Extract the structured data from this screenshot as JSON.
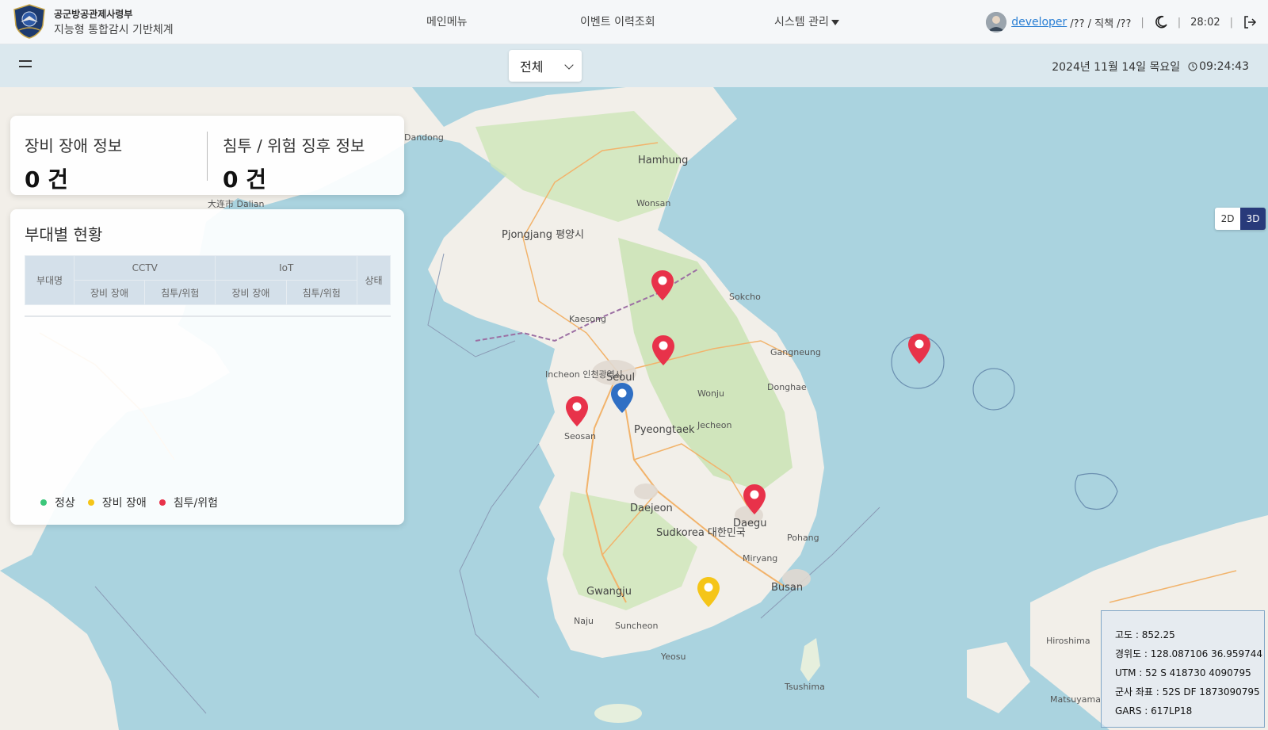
{
  "header": {
    "org_name": "공군방공관제사령부",
    "system_name": "지능형 통합감시 기반체계",
    "nav": {
      "main_menu": "메인메뉴",
      "event_history": "이벤트 이력조회",
      "system_admin": "시스템 관리"
    },
    "user": {
      "name": "developer",
      "rank_position": "/?? / 직책 /??",
      "session_time": "28:02"
    }
  },
  "subbar": {
    "filter_selected": "전체",
    "date": "2024년 11월 14일 목요일",
    "time": "09:24:43"
  },
  "stats": {
    "equipment_fault": {
      "title": "장비 장애 정보",
      "value": "0 건"
    },
    "intrusion": {
      "title": "침투 / 위험 징후 정보",
      "value": "0 건"
    }
  },
  "unit_status": {
    "title": "부대별 현황",
    "columns": {
      "unit_name": "부대명",
      "cctv": "CCTV",
      "iot": "IoT",
      "status": "상태",
      "cctv_fault": "장비 장애",
      "cctv_intrusion": "침투/위험",
      "iot_fault": "장비 장애",
      "iot_intrusion": "침투/위험"
    },
    "rows": [],
    "legend": [
      {
        "label": "정상",
        "color": "#3bc77a"
      },
      {
        "label": "장비 장애",
        "color": "#f5c518"
      },
      {
        "label": "침투/위험",
        "color": "#e8324a"
      }
    ]
  },
  "view_toggle": {
    "label_2d": "2D",
    "label_3d": "3D",
    "active": "3D"
  },
  "coordinates": {
    "altitude": "고도 : 852.25",
    "latlon": "경위도 : 128.087106 36.959744",
    "utm": "UTM : 52 S 418730 4090795",
    "military_grid": "군사 좌표 : 52S DF 1873090795",
    "gars": "GARS : 617LP18"
  },
  "colors": {
    "marker_alert": "#e8324a",
    "marker_current": "#2f6fc4",
    "marker_warning": "#f5c518",
    "toggle_active": "#283a7a"
  },
  "map_labels": {
    "seoul": "Seoul",
    "pyongyang": "Pjongjang 평양시",
    "daegu": "Daegu",
    "busan": "Busan",
    "daejeon": "Daejeon",
    "gwangju": "Gwangju",
    "pohang": "Pohang",
    "sudkorea": "Sudkorea 대한민국",
    "incheon": "Incheon 인천광역시",
    "pyeongtaek": "Pyeongtaek",
    "dalian": "大连市 Dalian",
    "gangneung": "Gangneung",
    "sokcho": "Sokcho",
    "wonju": "Wonju",
    "hamhung": "Hamhung",
    "wonsan": "Wonsan",
    "seosan": "Seosan",
    "jecheon": "Jecheon",
    "donghae": "Donghae",
    "naju": "Naju",
    "suncheon": "Suncheon",
    "yeosu": "Yeosu",
    "miryang": "Miryang",
    "tsushima": "Tsushima",
    "hiroshima": "Hiroshima",
    "matsuyama": "Matsuyama",
    "kaesong": "Kaesong",
    "dandong": "Dandong"
  }
}
